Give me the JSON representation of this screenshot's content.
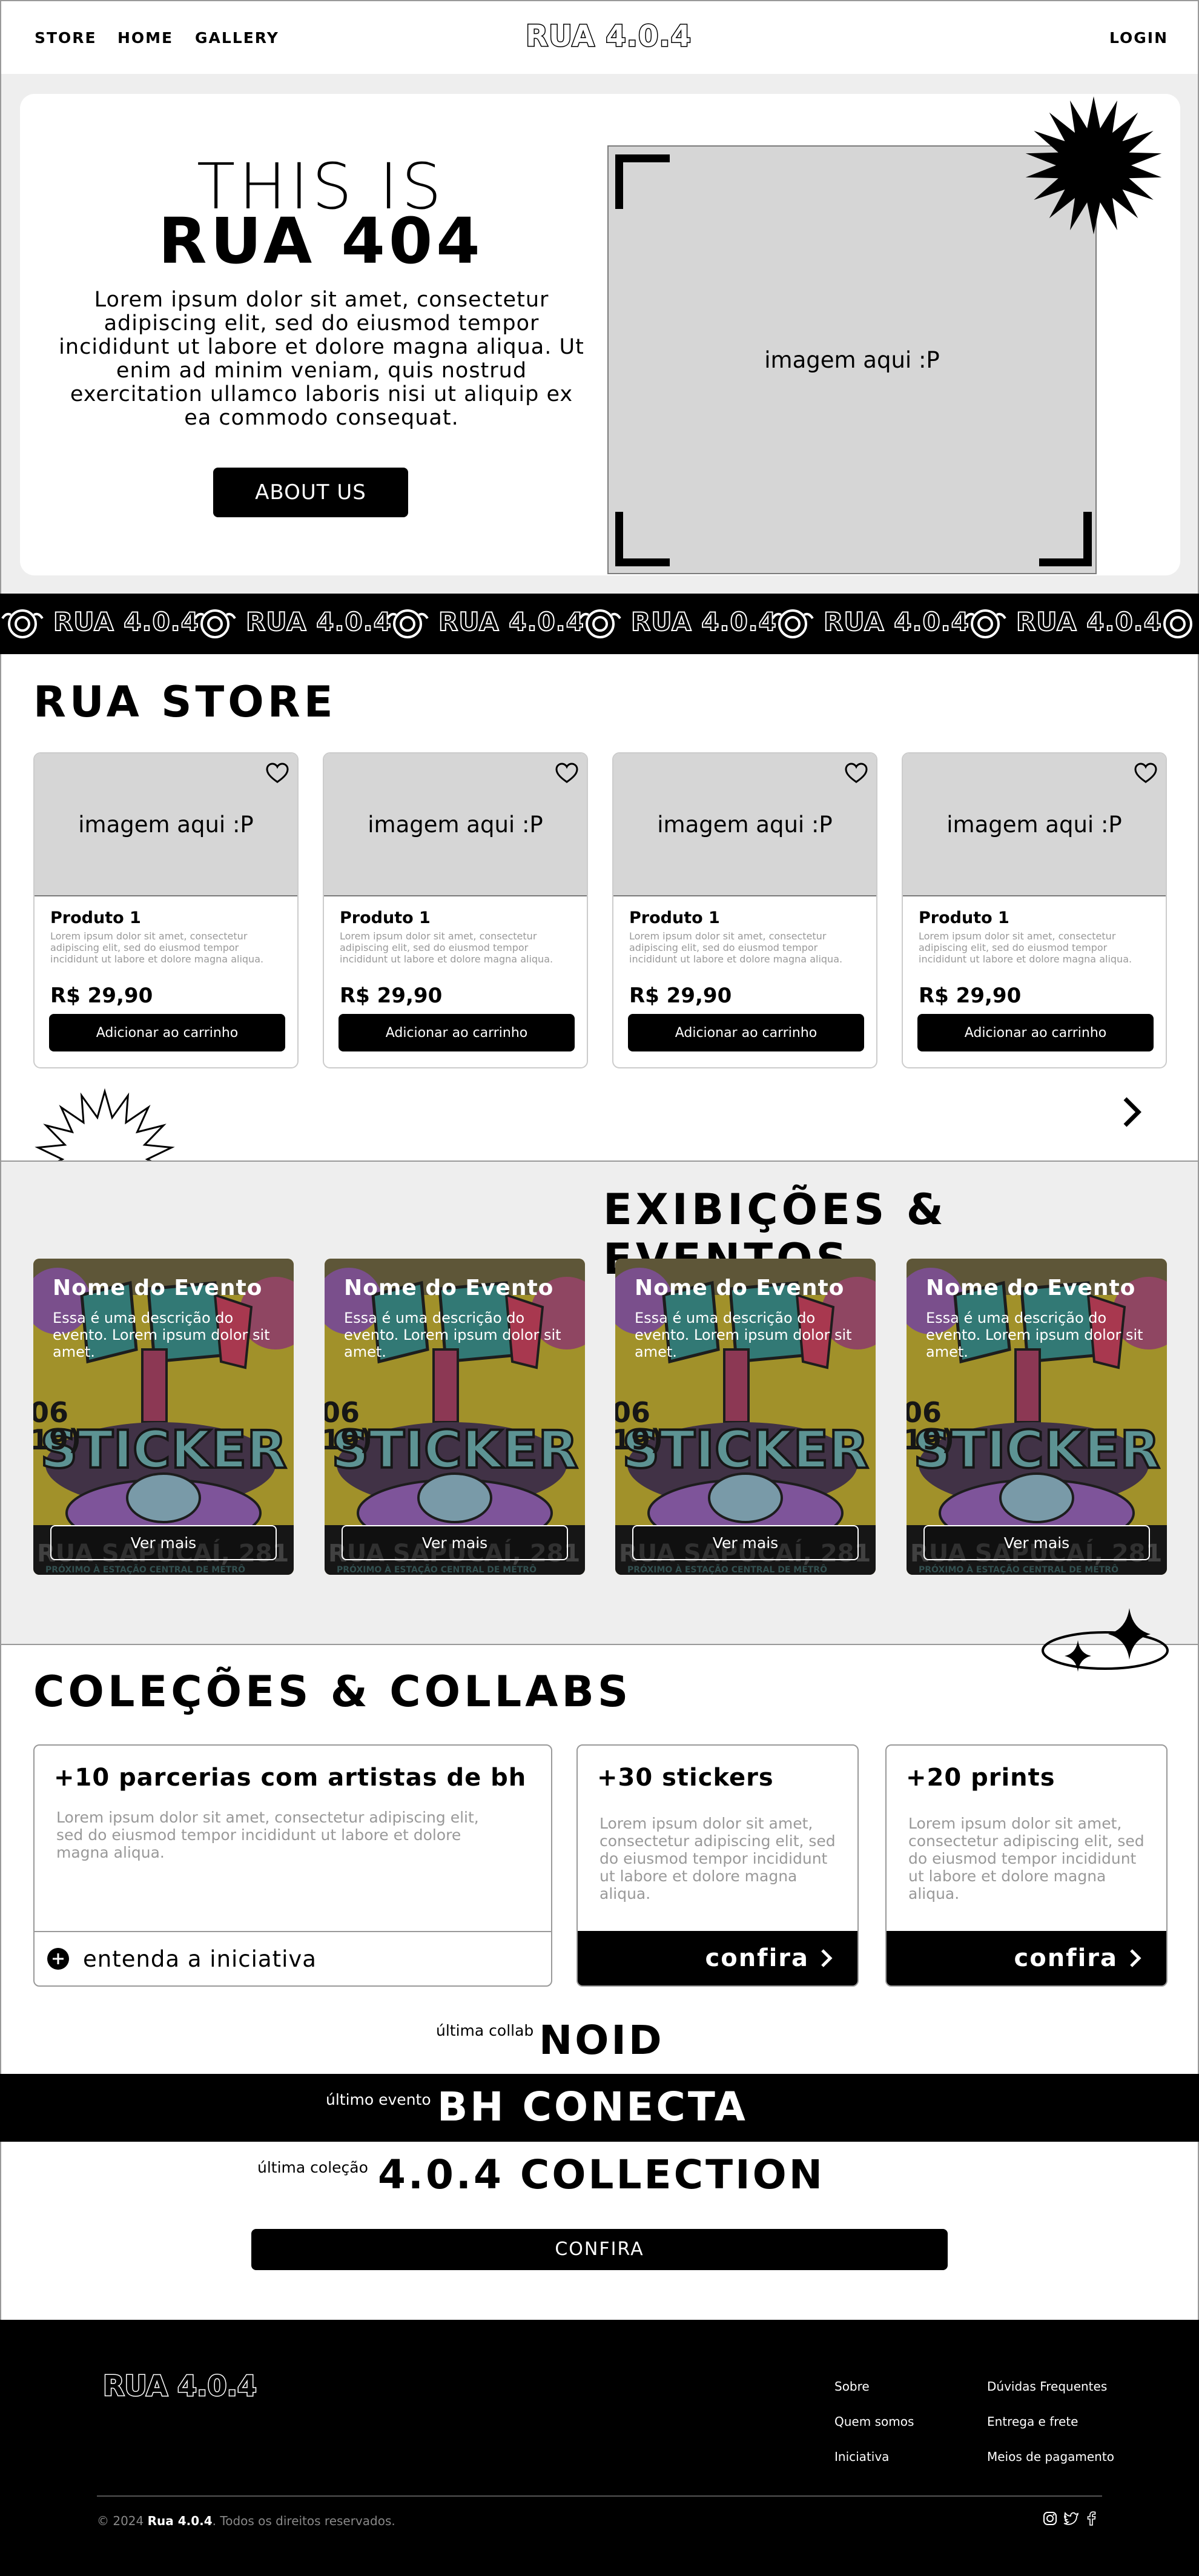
{
  "nav": {
    "store": "STORE",
    "home": "HOME",
    "gallery": "GALLERY",
    "logo": "RUA 4.0.4",
    "login": "LOGIN"
  },
  "hero": {
    "title_line1": "THIS IS",
    "title_line2": "RUA 404",
    "text": "Lorem ipsum dolor sit amet, consectetur adipiscing elit, sed do eiusmod tempor incididunt ut labore et dolore magna aliqua. Ut enim ad minim veniam, quis nostrud exercitation ullamco laboris nisi ut aliquip ex ea commodo consequat.",
    "button": "ABOUT US",
    "image_placeholder": "imagem aqui :P"
  },
  "ticker": {
    "items": [
      "RUA 4.0.4",
      "RUA 4.0.4",
      "RUA 4.0.4",
      "RUA 4.0.4",
      "RUA 4.0.4",
      "RUA 4.0.4"
    ]
  },
  "store": {
    "title": "RUA STORE",
    "products": [
      {
        "image": "imagem aqui :P",
        "name": "Produto 1",
        "description": "Lorem ipsum dolor sit amet, consectetur adipiscing elit, sed do eiusmod tempor incididunt ut labore et dolore magna aliqua.",
        "price": "R$ 29,90",
        "button": "Adicionar ao carrinho"
      },
      {
        "image": "imagem aqui :P",
        "name": "Produto 1",
        "description": "Lorem ipsum dolor sit amet, consectetur adipiscing elit, sed do eiusmod tempor incididunt ut labore et dolore magna aliqua.",
        "price": "R$ 29,90",
        "button": "Adicionar ao carrinho"
      },
      {
        "image": "imagem aqui :P",
        "name": "Produto 1",
        "description": "Lorem ipsum dolor sit amet, consectetur adipiscing elit, sed do eiusmod tempor incididunt ut labore et dolore magna aliqua.",
        "price": "R$ 29,90",
        "button": "Adicionar ao carrinho"
      },
      {
        "image": "imagem aqui :P",
        "name": "Produto 1",
        "description": "Lorem ipsum dolor sit amet, consectetur adipiscing elit, sed do eiusmod tempor incididunt ut labore et dolore magna aliqua.",
        "price": "R$ 29,90",
        "button": "Adicionar ao carrinho"
      }
    ]
  },
  "events": {
    "title": "EXIBIÇÕES & EVENTOS",
    "cards": [
      {
        "name": "Nome do Evento",
        "description": "Essa é uma descrição do evento. Lorem ipsum dolor sit amet.",
        "button": "Ver mais"
      },
      {
        "name": "Nome do Evento",
        "description": "Essa é uma descrição do evento. Lorem ipsum dolor sit amet.",
        "button": "Ver mais"
      },
      {
        "name": "Nome do Evento",
        "description": "Essa é uma descrição do evento. Lorem ipsum dolor sit amet.",
        "button": "Ver mais"
      },
      {
        "name": "Nome do Evento",
        "description": "Essa é uma descrição do evento. Lorem ipsum dolor sit amet.",
        "button": "Ver mais"
      }
    ],
    "poster_text": {
      "word": "STICKER",
      "address": "RUA SAPUCAÍ, 281",
      "note": "PRÓXIMO À ESTAÇÃO CENTRAL DE METRÔ"
    }
  },
  "collections": {
    "title": "COLEÇÕES & COLLABS",
    "cards": [
      {
        "title": "+10 parcerias com artistas de bh",
        "text": "Lorem ipsum dolor sit amet, consectetur adipiscing elit, sed do eiusmod tempor incididunt ut labore et dolore magna aliqua.",
        "action": "entenda a iniciativa"
      },
      {
        "title": "+30 stickers",
        "text": "Lorem ipsum dolor sit amet, consectetur adipiscing elit, sed do eiusmod tempor incididunt ut labore et dolore magna aliqua.",
        "action": "confira"
      },
      {
        "title": "+20 prints",
        "text": "Lorem ipsum dolor sit amet, consectetur adipiscing elit, sed do eiusmod tempor incididunt ut labore et dolore magna aliqua.",
        "action": "confira"
      }
    ],
    "latest_collab_label": "última collab",
    "latest_collab": "NOID",
    "latest_event_label": "último evento",
    "latest_event": "BH CONECTA",
    "latest_collection_label": "última coleção",
    "latest_collection": "4.0.4 COLLECTION",
    "button": "CONFIRA"
  },
  "footer": {
    "logo": "RUA 4.0.4",
    "col1": [
      "Sobre",
      "Quem somos",
      "Iniciativa"
    ],
    "col2": [
      "Dúvidas Frequentes",
      "Entrega e frete",
      "Meios de pagamento"
    ],
    "copyright_prefix": "© 2024",
    "copyright_brand": "Rua 4.0.4",
    "copyright_suffix": ". Todos os direitos reservados.",
    "social_icons": [
      "instagram-icon",
      "twitter-icon",
      "facebook-icon"
    ]
  }
}
